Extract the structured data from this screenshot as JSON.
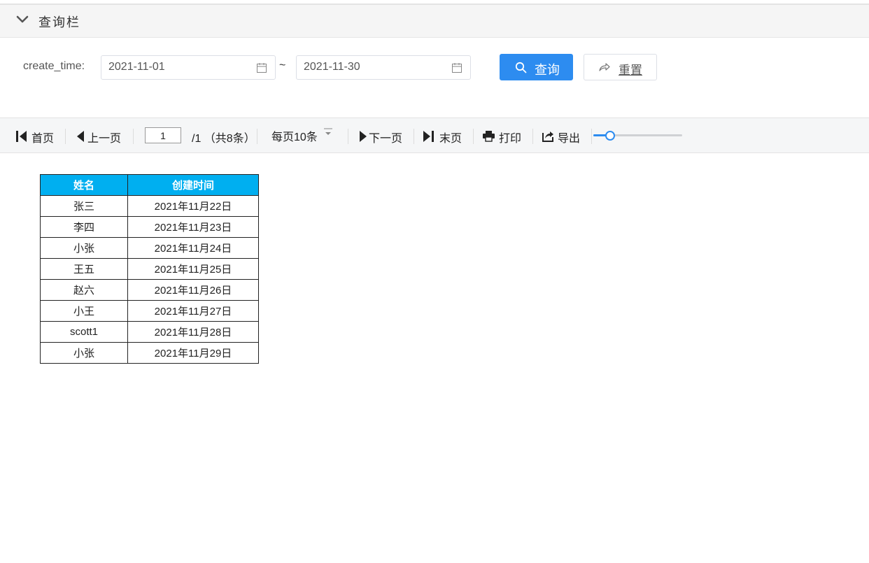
{
  "query_panel": {
    "title": "查询栏",
    "field_label": "create_time:",
    "start_date": "2021-11-01",
    "end_date": "2021-11-30",
    "separator": "~",
    "query_button": "查询",
    "reset_button": "重置"
  },
  "toolbar": {
    "first_page": "首页",
    "prev_page": "上一页",
    "current_page": "1",
    "page_total": "/1 （共8条）",
    "page_size": "每页10条",
    "next_page": "下一页",
    "last_page": "末页",
    "print": "打印",
    "export": "导出",
    "zoom_fraction": 0.15
  },
  "table": {
    "columns": [
      "姓名",
      "创建时间"
    ],
    "rows": [
      [
        "张三",
        "2021年11月22日"
      ],
      [
        "李四",
        "2021年11月23日"
      ],
      [
        "小张",
        "2021年11月24日"
      ],
      [
        "王五",
        "2021年11月25日"
      ],
      [
        "赵六",
        "2021年11月26日"
      ],
      [
        "小王",
        "2021年11月27日"
      ],
      [
        "scott1",
        "2021年11月28日"
      ],
      [
        "小张",
        "2021年11月29日"
      ]
    ]
  },
  "colors": {
    "accent": "#2d8cf0",
    "table_header": "#00aff0"
  }
}
